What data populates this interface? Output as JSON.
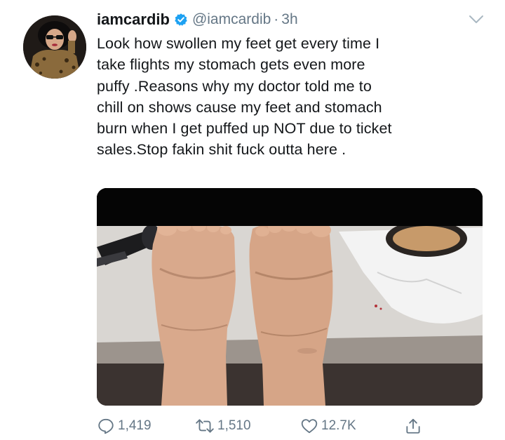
{
  "header": {
    "display_name": "iamcardib",
    "handle": "@iamcardib",
    "separator": "·",
    "time": "3h"
  },
  "tweet": {
    "text": "Look how swollen my feet get every time I\ntake flights my stomach gets even more\npuffy .Reasons why my doctor told me to\nchill on shows cause my feet and stomach\nburn when I get puffed up NOT due to ticket\nsales.Stop fakin shit fuck outta here ."
  },
  "actions": {
    "replies": "1,419",
    "retweets": "1,510",
    "likes": "12.7K"
  },
  "icons": {
    "verified": "verified-badge-icon",
    "caret": "chevron-down-icon",
    "reply": "reply-icon",
    "retweet": "retweet-icon",
    "like": "heart-icon",
    "share": "share-icon"
  },
  "colors": {
    "verified_blue": "#1da1f2",
    "secondary_text": "#657786",
    "primary_text": "#14171a"
  }
}
